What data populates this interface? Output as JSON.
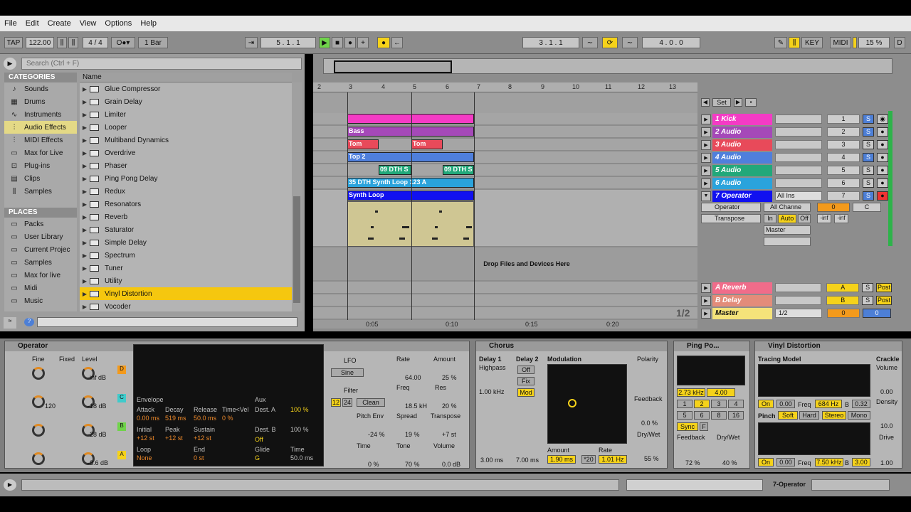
{
  "menu": [
    "File",
    "Edit",
    "Create",
    "View",
    "Options",
    "Help"
  ],
  "transport": {
    "tap": "TAP",
    "tempo": "122.00",
    "sig": "4 / 4",
    "quant": "1 Bar",
    "pos": "5 .  1 .  1",
    "loop_start": "3 .  1 .  1",
    "loop_len": "4 .  0 .  0",
    "key": "KEY",
    "midi": "MIDI",
    "cpu": "15 %",
    "d": "D"
  },
  "browser": {
    "search_placeholder": "Search (Ctrl + F)",
    "categories_header": "CATEGORIES",
    "categories": [
      {
        "label": "Sounds",
        "icon": "note-icon"
      },
      {
        "label": "Drums",
        "icon": "drum-icon"
      },
      {
        "label": "Instruments",
        "icon": "instrument-icon"
      },
      {
        "label": "Audio Effects",
        "icon": "audio-effects-icon"
      },
      {
        "label": "MIDI Effects",
        "icon": "midi-effects-icon"
      },
      {
        "label": "Max for Live",
        "icon": "max-icon"
      },
      {
        "label": "Plug-ins",
        "icon": "plugin-icon"
      },
      {
        "label": "Clips",
        "icon": "clips-icon"
      },
      {
        "label": "Samples",
        "icon": "samples-icon"
      }
    ],
    "places_header": "PLACES",
    "places": [
      "Packs",
      "User Library",
      "Current Projec",
      "Samples",
      "Max for live",
      "Midi",
      "Music"
    ],
    "name_header": "Name",
    "items": [
      "Glue Compressor",
      "Grain Delay",
      "Limiter",
      "Looper",
      "Multiband Dynamics",
      "Overdrive",
      "Phaser",
      "Ping Pong Delay",
      "Redux",
      "Resonators",
      "Reverb",
      "Saturator",
      "Simple Delay",
      "Spectrum",
      "Tuner",
      "Utility",
      "Vinyl Distortion",
      "Vocoder"
    ],
    "selected_item": "Vinyl Distortion"
  },
  "arrangement": {
    "ruler": [
      "2",
      "3",
      "4",
      "5",
      "6",
      "7",
      "8",
      "9",
      "10",
      "11",
      "12",
      "13"
    ],
    "drop_text": "Drop Files and Devices Here",
    "time_labels": [
      "0:05",
      "0:10",
      "0:15",
      "0:20"
    ],
    "zoom": "1/2",
    "set_label": "Set",
    "clips": [
      {
        "lane": 0,
        "label": "",
        "color": "#f43bc5"
      },
      {
        "lane": 1,
        "label": "Bass",
        "color": "#a549b8"
      },
      {
        "lane": 2,
        "label": "Tom",
        "color": "#e84a5a"
      },
      {
        "lane": 2,
        "label": "Tom",
        "color": "#e84a5a"
      },
      {
        "lane": 3,
        "label": "Top 2",
        "color": "#4f7fdc"
      },
      {
        "lane": 4,
        "label": "09 DTH S",
        "color": "#22a87a"
      },
      {
        "lane": 4,
        "label": "09 DTH S",
        "color": "#22a87a"
      },
      {
        "lane": 5,
        "label": "35 DTH Synth Loop 123 A",
        "color": "#2aa3dc"
      },
      {
        "lane": 6,
        "label": "Synth Loop",
        "color": "#1111f0"
      }
    ],
    "tracks": [
      {
        "name": "1 Kick",
        "color": "#f43bc5",
        "num": "1"
      },
      {
        "name": "2 Audio",
        "color": "#a549b8",
        "num": "2"
      },
      {
        "name": "3 Audio",
        "color": "#e84a5a",
        "num": "3"
      },
      {
        "name": "4 Audio",
        "color": "#4f7fdc",
        "num": "4"
      },
      {
        "name": "5 Audio",
        "color": "#22a87a",
        "num": "5"
      },
      {
        "name": "6 Audio",
        "color": "#2aa3dc",
        "num": "6"
      },
      {
        "name": "7 Operator",
        "color": "#1111f0",
        "num": "7"
      }
    ],
    "track7": {
      "input": "All Ins",
      "channel": "All Channe",
      "device": "Operator",
      "param": "Transpose",
      "vol": "0",
      "pan": "C",
      "mon_in": "In",
      "mon_auto": "Auto",
      "mon_off": "Off",
      "out": "Master",
      "inf1": "-inf",
      "inf2": "-inf"
    },
    "returns": [
      {
        "name": "A Reverb",
        "color": "#f06c8a",
        "letter": "A",
        "post": "Post"
      },
      {
        "name": "B Delay",
        "color": "#e38c7a",
        "letter": "B",
        "post": "Post"
      },
      {
        "name": "Master",
        "color": "#f5e37a",
        "letter": "0",
        "post": "0"
      }
    ],
    "master_sel": "1/2"
  },
  "devices": {
    "operator": {
      "title": "Operator",
      "rows": [
        {
          "level": "-inf dB",
          "letter": "D",
          "fine": "0"
        },
        {
          "level": "-18 dB",
          "letter": "C",
          "fine": "120"
        },
        {
          "level": "-28 dB",
          "letter": "B",
          "fine": "0"
        },
        {
          "level": "-8.6 dB",
          "letter": "A",
          "fine": "0"
        }
      ],
      "fine": "Fine",
      "fixed": "Fixed",
      "level": "Level",
      "env": {
        "envelope": "Envelope",
        "attack": "Attack",
        "attack_v": "0.00 ms",
        "decay": "Decay",
        "decay_v": "519 ms",
        "release": "Release",
        "release_v": "50.0 ms",
        "time": "Time<Vel",
        "time_v": "0 %",
        "initial": "Initial",
        "initial_v": "+12 st",
        "peak": "Peak",
        "peak_v": "+12 st",
        "sustain": "Sustain",
        "sustain_v": "+12 st",
        "loop": "Loop",
        "loop_v": "None",
        "end": "End",
        "end_v": "0 st",
        "aux": "Aux",
        "aux_v": "100 %",
        "desta": "Dest. A",
        "destb": "Dest. B",
        "destb_v": "100 %",
        "off": "Off",
        "glide": "Glide",
        "glide_v": "G",
        "gtime": "Time",
        "gtime_v": "50.0 ms"
      },
      "lfo": "LFO",
      "sine": "Sine",
      "rate": "Rate",
      "rate_v": "64.00",
      "amount": "Amount",
      "amount_v": "25 %",
      "filter": "Filter",
      "freq": "Freq",
      "freq_v": "18.5 kH",
      "res": "Res",
      "res_v": "20 %",
      "v12": "12",
      "v24": "24",
      "clean": "Clean",
      "pitchenv": "Pitch Env",
      "pitchenv_v": "-24 %",
      "spread": "Spread",
      "spread_v": "19 %",
      "transpose": "Transpose",
      "transpose_v": "+7 st",
      "time": "Time",
      "time_v": "0 %",
      "tone": "Tone",
      "tone_v": "70 %",
      "volume": "Volume",
      "volume_v": "0.0 dB"
    },
    "chorus": {
      "title": "Chorus",
      "delay1": "Delay 1",
      "highpass": "Highpass",
      "hp_v": "1.00 kHz",
      "delay2": "Delay 2",
      "off": "Off",
      "fix": "Fix",
      "mod": "Mod",
      "d1": "3.00 ms",
      "d2": "7.00 ms",
      "modulation": "Modulation",
      "amount": "Amount",
      "amount_v": "1.90 ms",
      "rate": "Rate",
      "rate_x": "*20",
      "rate_v": "1.01 Hz",
      "polarity": "Polarity",
      "feedback": "Feedback",
      "feedback_v": "0.0 %",
      "drywet": "Dry/Wet",
      "drywet_v": "55 %"
    },
    "pingpong": {
      "title": "Ping Po...",
      "freq": "2.73 kHz",
      "width": "4.00",
      "sync": "Sync",
      "f": "F",
      "feedback": "Feedback",
      "feedback_v": "72 %",
      "drywet": "Dry/Wet",
      "drywet_v": "40 %",
      "grid": [
        "1",
        "2",
        "3",
        "4",
        "5",
        "6",
        "8",
        "16"
      ]
    },
    "vinyl": {
      "title": "Vinyl Distortion",
      "tracing": "Tracing Model",
      "on": "On",
      "v0": "0.00",
      "freq": "Freq",
      "freq_v": "684 Hz",
      "b": "B",
      "b_v": "0.32",
      "pinch": "Pinch",
      "soft": "Soft",
      "hard": "Hard",
      "stereo": "Stereo",
      "mono": "Mono",
      "freq2_v": "7.50 kHz",
      "b2_v": "3.00",
      "crackle": "Crackle",
      "volume": "Volume",
      "volume_v": "0.00",
      "density": "Density",
      "density_v": "10.0",
      "drive": "Drive",
      "drive_v": "1.00"
    }
  },
  "statusbar": {
    "track": "7-Operator"
  }
}
